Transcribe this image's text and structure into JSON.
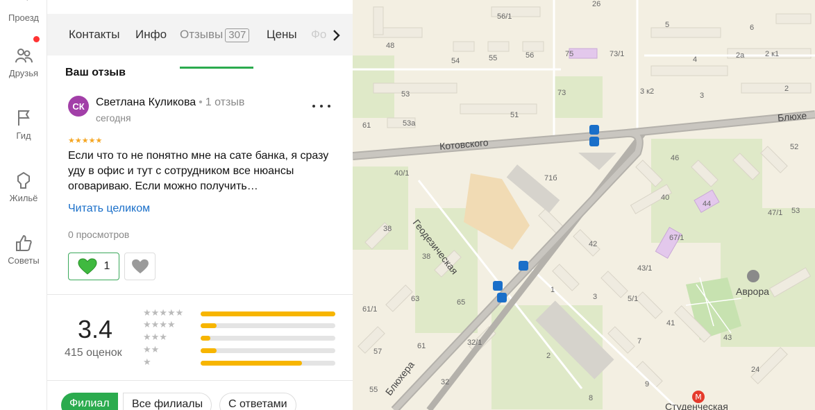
{
  "rail": {
    "items": [
      {
        "label": "Проезд",
        "icon": "route-icon"
      },
      {
        "label": "Друзья",
        "icon": "friends-icon"
      },
      {
        "label": "Гид",
        "icon": "flag-icon"
      },
      {
        "label": "Жильё",
        "icon": "house-icon"
      },
      {
        "label": "Советы",
        "icon": "thumbs-up-icon"
      }
    ]
  },
  "tabs": {
    "items": [
      "Контакты",
      "Инфо",
      "Отзывы",
      "Цены",
      "Фо"
    ],
    "reviews_count": "307",
    "active": "Отзывы"
  },
  "review": {
    "section_title": "Ваш отзыв",
    "avatar_initials": "СК",
    "author": "Светлана Куликова",
    "author_reviews": "1 отзыв",
    "date": "сегодня",
    "stars": "★★★★★",
    "text": "Если что то не понятно мне на сате банка, я сразу уду в офис и тут с сотрудником все нюансы оговариваю. Если можно получить…",
    "read_more": "Читать целиком",
    "views": "0 просмотров",
    "likes": "1"
  },
  "rating": {
    "value": "3.4",
    "count": "415 оценок",
    "distribution": [
      {
        "stars": "★★★★★",
        "fraction": 1.0
      },
      {
        "stars": "★★★★",
        "fraction": 0.12
      },
      {
        "stars": "★★★",
        "fraction": 0.07
      },
      {
        "stars": "★★",
        "fraction": 0.12
      },
      {
        "stars": "★",
        "fraction": 0.75
      }
    ],
    "bar_color": "#f7b500"
  },
  "filters": [
    "Филиал",
    "Все филиалы",
    "С ответами"
  ],
  "map": {
    "streets": [
      "Котовского",
      "Геодезическая",
      "Блюхе",
      "Блюхера",
      "Студенческая"
    ],
    "places": [
      "Аврора"
    ],
    "house_numbers": [
      "56/1",
      "26",
      "48",
      "54",
      "55",
      "56",
      "75",
      "73/1",
      "5",
      "6",
      "4",
      "2a",
      "2 к1",
      "53",
      "73",
      "3 к2",
      "3",
      "2",
      "61",
      "53a",
      "51",
      "46",
      "52",
      "40/1",
      "71б",
      "40",
      "44",
      "53",
      "47/1",
      "38",
      "42",
      "67/1",
      "38",
      "43/1",
      "63",
      "65",
      "1",
      "3",
      "5/1",
      "61/1",
      "61",
      "32/1",
      "7",
      "41",
      "43",
      "57",
      "2",
      "9",
      "24",
      "55",
      "32",
      "8"
    ]
  },
  "colors": {
    "accent": "#2bab4e",
    "link": "#1a6fc9",
    "avatar": "#a23fa8"
  }
}
